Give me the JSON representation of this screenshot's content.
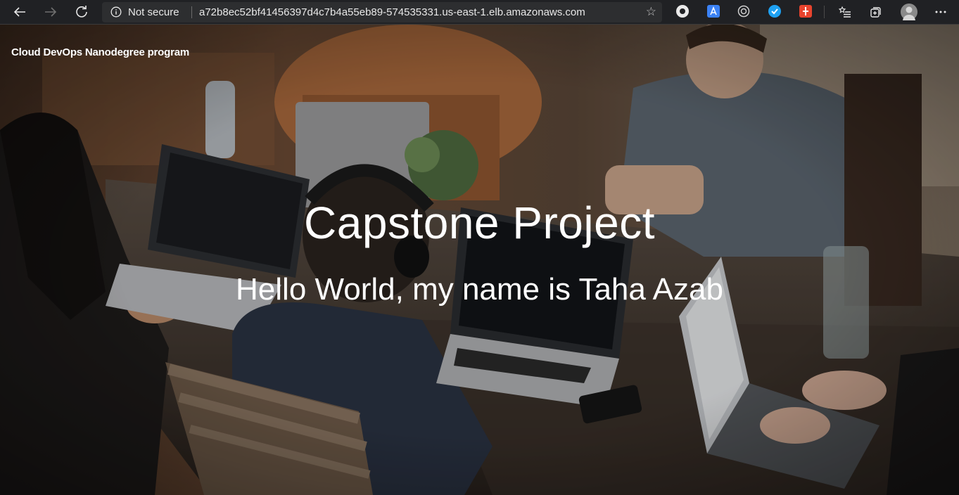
{
  "toolbar": {
    "security_label": "Not secure",
    "url": "a72b8ec52bf41456397d4c7b4a55eb89-574535331.us-east-1.elb.amazonaws.com"
  },
  "icons": {
    "back": "back-arrow-icon",
    "forward": "forward-arrow-icon",
    "refresh": "refresh-icon",
    "info": "info-icon",
    "favorite": "star-icon",
    "favorites_list": "favorites-list-icon",
    "collections": "collections-icon",
    "profile": "profile-avatar",
    "menu": "more-menu-icon"
  },
  "page": {
    "brand": "Cloud DevOps Nanodegree program",
    "title": "Capstone Project",
    "subtitle": "Hello World, my name is Taha Azab"
  },
  "colors": {
    "toolbar_bg": "#202124",
    "address_bg": "#2d2e30",
    "text": "#ffffff"
  }
}
